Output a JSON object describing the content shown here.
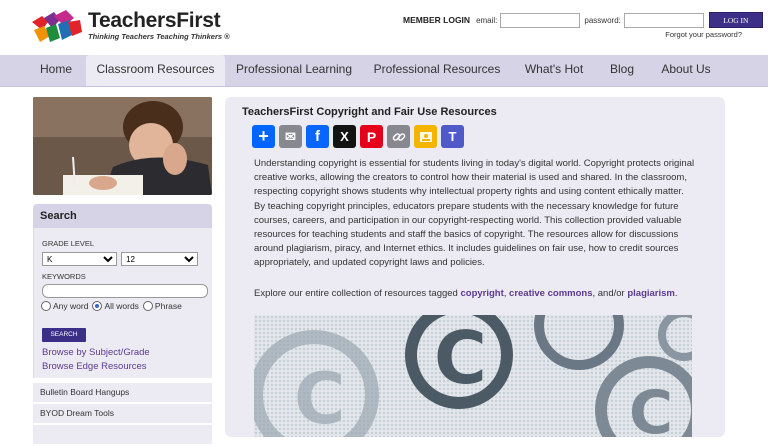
{
  "header": {
    "brand": "TeachersFirst",
    "tagline": "Thinking Teachers Teaching Thinkers ®",
    "member_login": "MEMBER LOGIN",
    "email_label": "email:",
    "password_label": "password:",
    "login_button": "LOG IN",
    "forgot": "Forgot your password?"
  },
  "nav": {
    "items": [
      {
        "label": "Home"
      },
      {
        "label": "Classroom Resources"
      },
      {
        "label": "Professional Learning"
      },
      {
        "label": "Professional Resources"
      },
      {
        "label": "What's Hot"
      },
      {
        "label": "Blog"
      },
      {
        "label": "About Us"
      }
    ],
    "active": "Classroom Resources"
  },
  "sidebar": {
    "search_title": "Search",
    "grade_level": "GRADE LEVEL",
    "grade_from": "K",
    "grade_to": "12",
    "keywords": "KEYWORDS",
    "radio_any": "Any word",
    "radio_all": "All words",
    "radio_phrase": "Phrase",
    "selected_radio": "All words",
    "search_button": "SEARCH",
    "browse_subject": "Browse by Subject/Grade",
    "browse_edge": "Browse Edge Resources",
    "list": [
      {
        "label": "Bulletin Board Hangups"
      },
      {
        "label": "BYOD Dream Tools"
      },
      {
        "label": ""
      }
    ]
  },
  "main": {
    "title": "TeachersFirst Copyright and Fair Use Resources",
    "share": [
      {
        "icon": "add-share-icon",
        "color": "#0166ff",
        "glyph": "+"
      },
      {
        "icon": "email-icon",
        "color": "#888990",
        "glyph": "✉"
      },
      {
        "icon": "facebook-icon",
        "color": "#0866ff",
        "glyph": "f"
      },
      {
        "icon": "x-icon",
        "color": "#131313",
        "glyph": "𝕏"
      },
      {
        "icon": "pinterest-icon",
        "color": "#e60019",
        "glyph": "P"
      },
      {
        "icon": "copy-link-icon",
        "color": "#888990",
        "glyph": "🔗"
      },
      {
        "icon": "google-classroom-icon",
        "color": "#f4b400",
        "glyph": "▣"
      },
      {
        "icon": "microsoft-teams-icon",
        "color": "#5059c9",
        "glyph": "T"
      }
    ],
    "paragraph": "Understanding copyright is essential for students living in today's digital world. Copyright protects original creative works, allowing the creators to control how their material is used and shared. In the classroom, respecting copyright shows students why intellectual property rights and using content ethically matter. By teaching copyright principles, educators prepare students with the necessary knowledge for future courses, careers, and participation in our copyright-respecting world. This collection provided valuable resources for teaching students and staff the basics of copyright. The resources allow for discussions around plagiarism, piracy, and Internet ethics. It includes guidelines on fair use, how to credit sources appropriately, and updated copyright laws and policies.",
    "explore_prefix": "Explore our entire collection of resources tagged",
    "tag1": "copyright",
    "sep1": ",",
    "tag2": "creative commons",
    "sep2": ", and/or",
    "tag3": "plagiarism",
    "end": "."
  },
  "colors": {
    "nav_bg": "#d6d3e6",
    "panel_bg": "#ecebf3",
    "button": "#3b2f87",
    "link": "#5c3a8f"
  }
}
